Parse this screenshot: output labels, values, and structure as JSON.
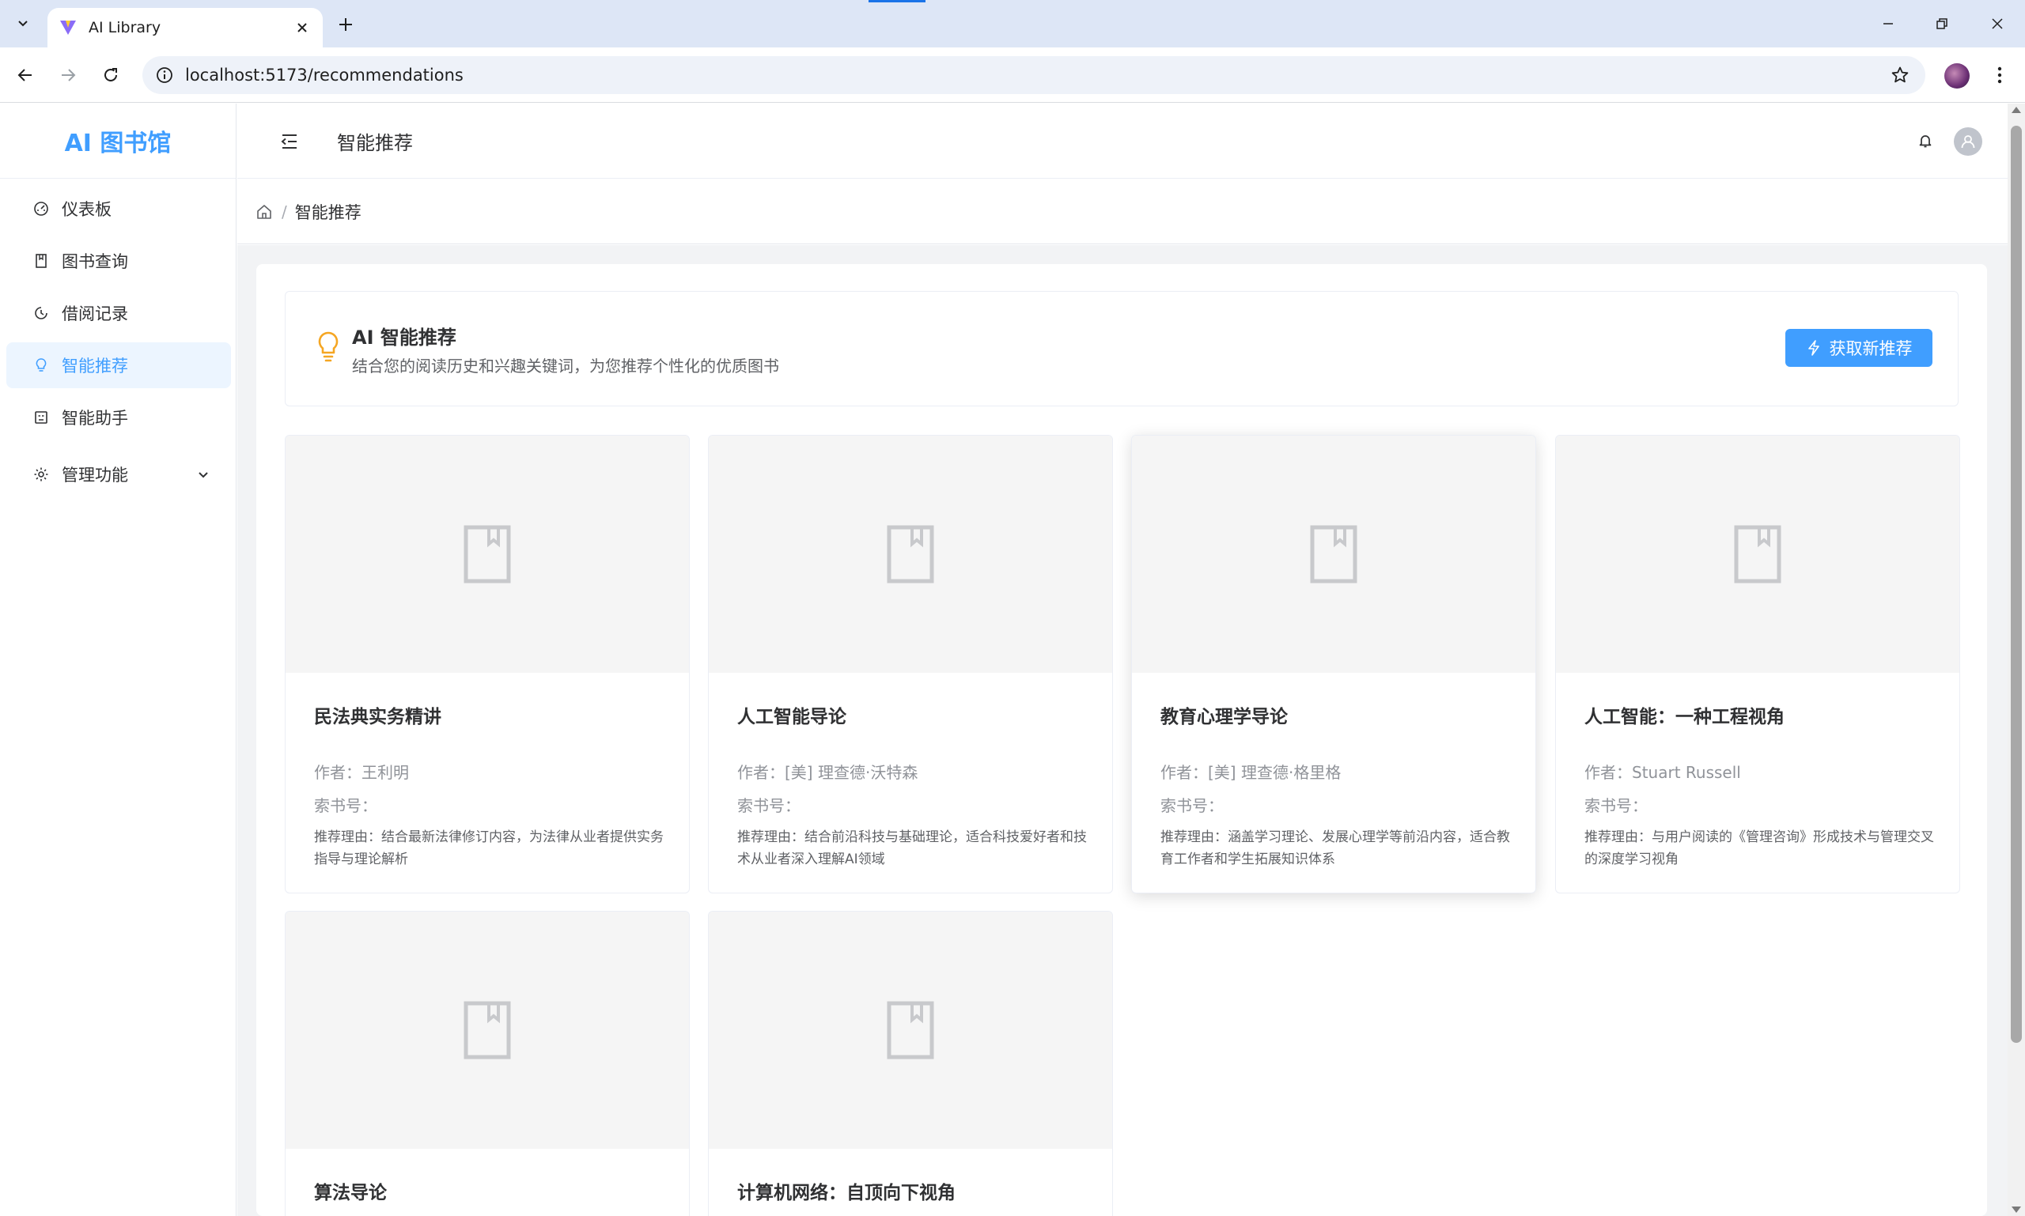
{
  "browser": {
    "tab_title": "AI Library",
    "url": "localhost:5173/recommendations"
  },
  "sidebar": {
    "logo": "AI 图书馆",
    "items": [
      {
        "label": "仪表板",
        "icon": "dashboard-icon"
      },
      {
        "label": "图书查询",
        "icon": "book-icon"
      },
      {
        "label": "借阅记录",
        "icon": "clock-icon"
      },
      {
        "label": "智能推荐",
        "icon": "lightbulb-icon",
        "active": true
      },
      {
        "label": "智能助手",
        "icon": "assistant-icon"
      },
      {
        "label": "管理功能",
        "icon": "gear-icon"
      }
    ]
  },
  "header": {
    "title": "智能推荐"
  },
  "breadcrumb": {
    "separator": "/",
    "current": "智能推荐"
  },
  "recommend": {
    "title": "AI 智能推荐",
    "subtitle": "结合您的阅读历史和兴趣关键词，为您推荐个性化的优质图书",
    "refresh_label": "获取新推荐"
  },
  "books": [
    {
      "title": "民法典实务精讲",
      "author": "作者：王利明",
      "call_number": "索书号：",
      "reason": "推荐理由：结合最新法律修订内容，为法律从业者提供实务指导与理论解析"
    },
    {
      "title": "人工智能导论",
      "author": "作者：[美] 理查德·沃特森",
      "call_number": "索书号：",
      "reason": "推荐理由：结合前沿科技与基础理论，适合科技爱好者和技术从业者深入理解AI领域"
    },
    {
      "title": "教育心理学导论",
      "author": "作者：[美] 理查德·格里格",
      "call_number": "索书号：",
      "reason": "推荐理由：涵盖学习理论、发展心理学等前沿内容，适合教育工作者和学生拓展知识体系"
    },
    {
      "title": "人工智能：一种工程视角",
      "author": "作者：Stuart Russell",
      "call_number": "索书号：",
      "reason": "推荐理由：与用户阅读的《管理咨询》形成技术与管理交叉的深度学习视角"
    },
    {
      "title": "算法导论",
      "author": "",
      "call_number": "",
      "reason": ""
    },
    {
      "title": "计算机网络：自顶向下视角",
      "author": "",
      "call_number": "",
      "reason": ""
    }
  ],
  "colors": {
    "accent": "#409eff",
    "active_bg": "#ecf5ff",
    "bulb": "#f5a623",
    "page_bg": "#f2f3f5"
  }
}
